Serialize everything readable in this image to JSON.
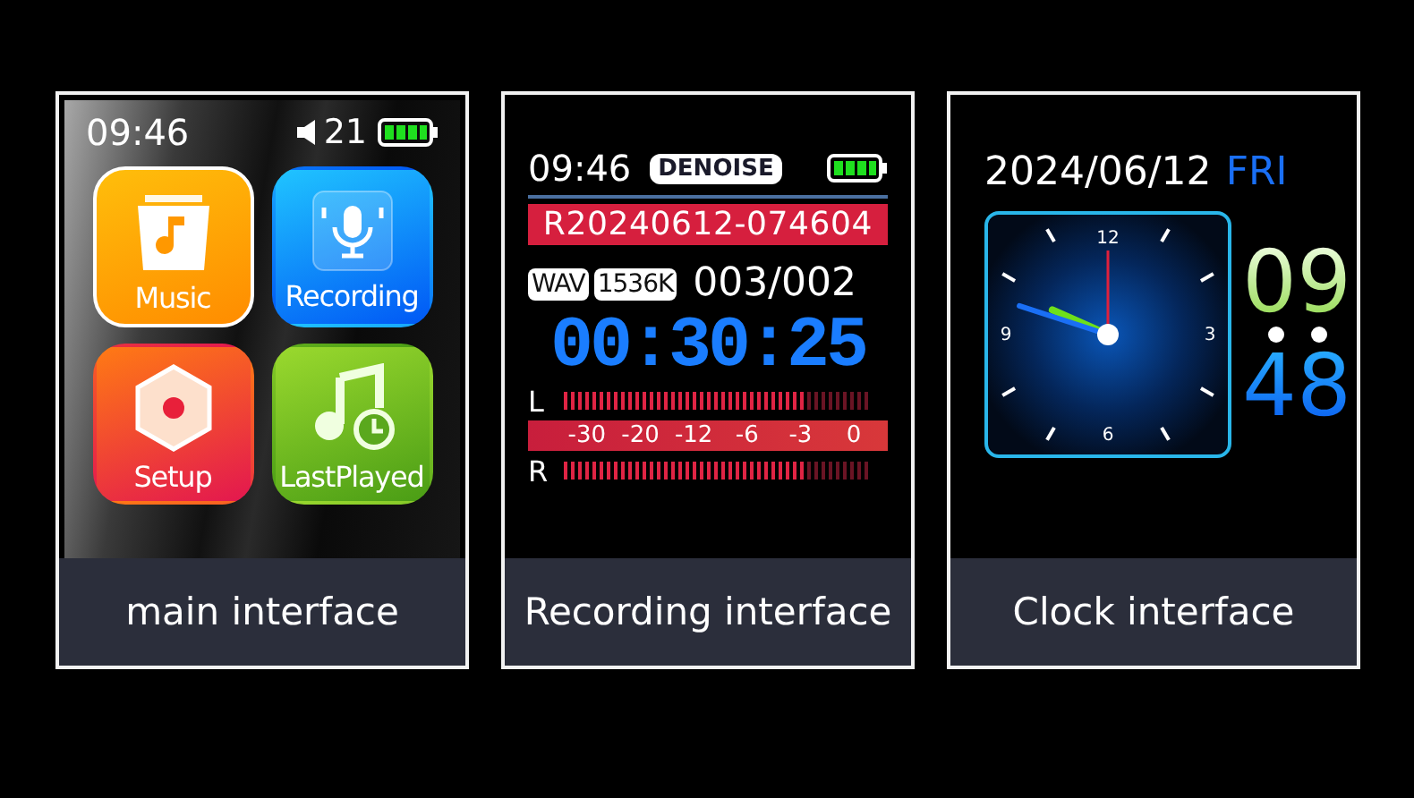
{
  "panels": [
    {
      "kind": "home",
      "caption": "main interface",
      "time": "09:46",
      "volume": "21",
      "apps": [
        {
          "label": "Music",
          "kind": "music",
          "selected": true
        },
        {
          "label": "Recording",
          "kind": "mic",
          "selected": false
        },
        {
          "label": "Setup",
          "kind": "setup",
          "selected": false
        },
        {
          "label": "LastPlayed",
          "kind": "history",
          "selected": false
        }
      ]
    },
    {
      "kind": "recording",
      "caption": "Recording interface",
      "time": "09:46",
      "badge": "DENOISE",
      "filename": "R20240612-074604",
      "format": "WAV",
      "bitrate": "1536K",
      "counter": "003/002",
      "elapsed": "00:30:25",
      "scale": [
        "-30",
        "-20",
        "-12",
        "-6",
        "-3",
        "0"
      ],
      "channels": [
        {
          "label": "L",
          "level": 0.78
        },
        {
          "label": "R",
          "level": 0.78
        }
      ]
    },
    {
      "kind": "clock",
      "caption": "Clock interface",
      "date": "2024/06/12",
      "weekday": "FRI",
      "hours": "09",
      "minutes": "48",
      "dial": [
        "12",
        "3",
        "6",
        "9"
      ]
    }
  ]
}
